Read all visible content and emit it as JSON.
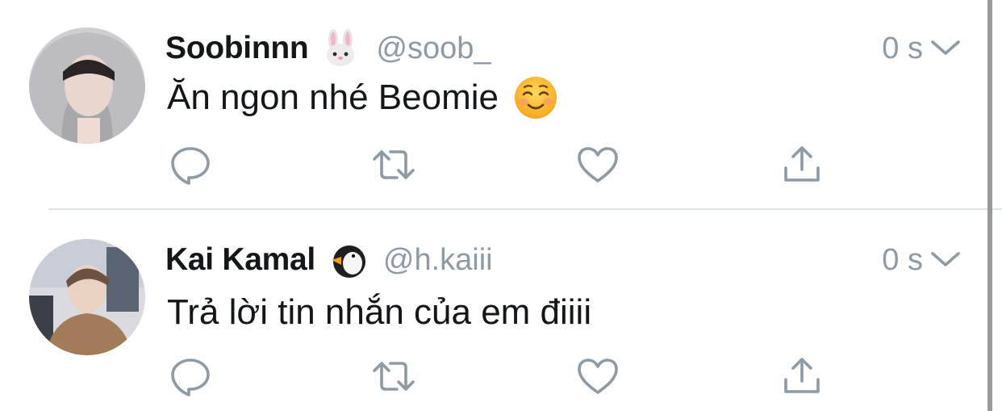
{
  "tweets": [
    {
      "display_name": "Soobinnn",
      "name_emoji": "rabbit-face-emoji",
      "handle": "@soob_",
      "time": "0 s",
      "text": "Ăn ngon nhé Beomie",
      "text_emoji": "smiling-face-emoji"
    },
    {
      "display_name": "Kai Kamal",
      "name_emoji": "penguin-emoji",
      "handle": "@h.kaiii",
      "time": "0 s",
      "text": "Trả lời tin nhắn của em điiii"
    }
  ],
  "colors": {
    "name": "#14171a",
    "secondary": "#8e9aa4",
    "icon": "#8e9aa4",
    "divider": "#dde3e8"
  },
  "icons": {
    "reply": "reply-icon",
    "retweet": "retweet-icon",
    "like": "heart-icon",
    "share": "share-icon",
    "more": "chevron-down-icon"
  }
}
